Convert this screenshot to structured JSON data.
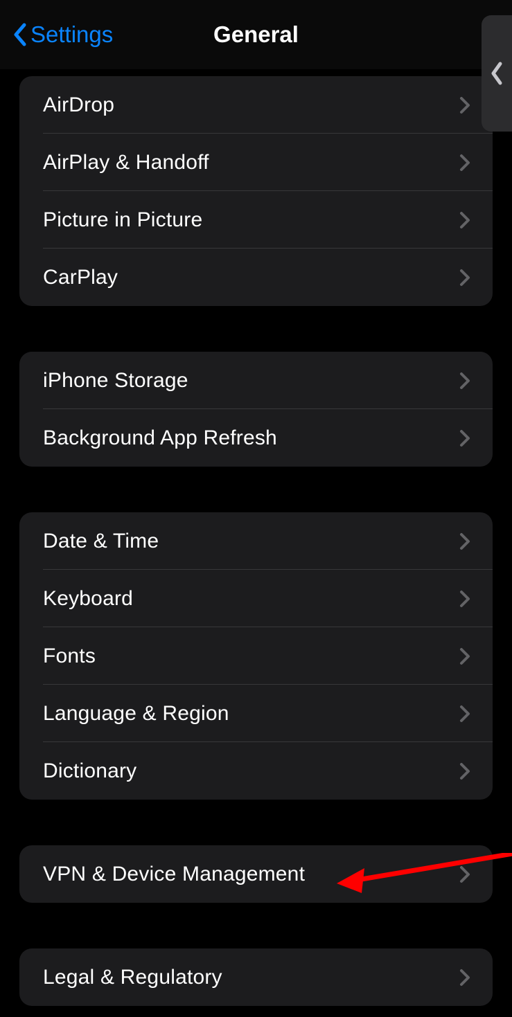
{
  "header": {
    "back_label": "Settings",
    "title": "General"
  },
  "sections": [
    {
      "rows": [
        {
          "label": "AirDrop"
        },
        {
          "label": "AirPlay & Handoff"
        },
        {
          "label": "Picture in Picture"
        },
        {
          "label": "CarPlay"
        }
      ]
    },
    {
      "rows": [
        {
          "label": "iPhone Storage"
        },
        {
          "label": "Background App Refresh"
        }
      ]
    },
    {
      "rows": [
        {
          "label": "Date & Time"
        },
        {
          "label": "Keyboard"
        },
        {
          "label": "Fonts"
        },
        {
          "label": "Language & Region"
        },
        {
          "label": "Dictionary"
        }
      ]
    },
    {
      "rows": [
        {
          "label": "VPN & Device Management"
        }
      ]
    },
    {
      "rows": [
        {
          "label": "Legal & Regulatory"
        }
      ]
    }
  ],
  "colors": {
    "accent": "#0a84ff",
    "annotation": "#ff0000"
  }
}
